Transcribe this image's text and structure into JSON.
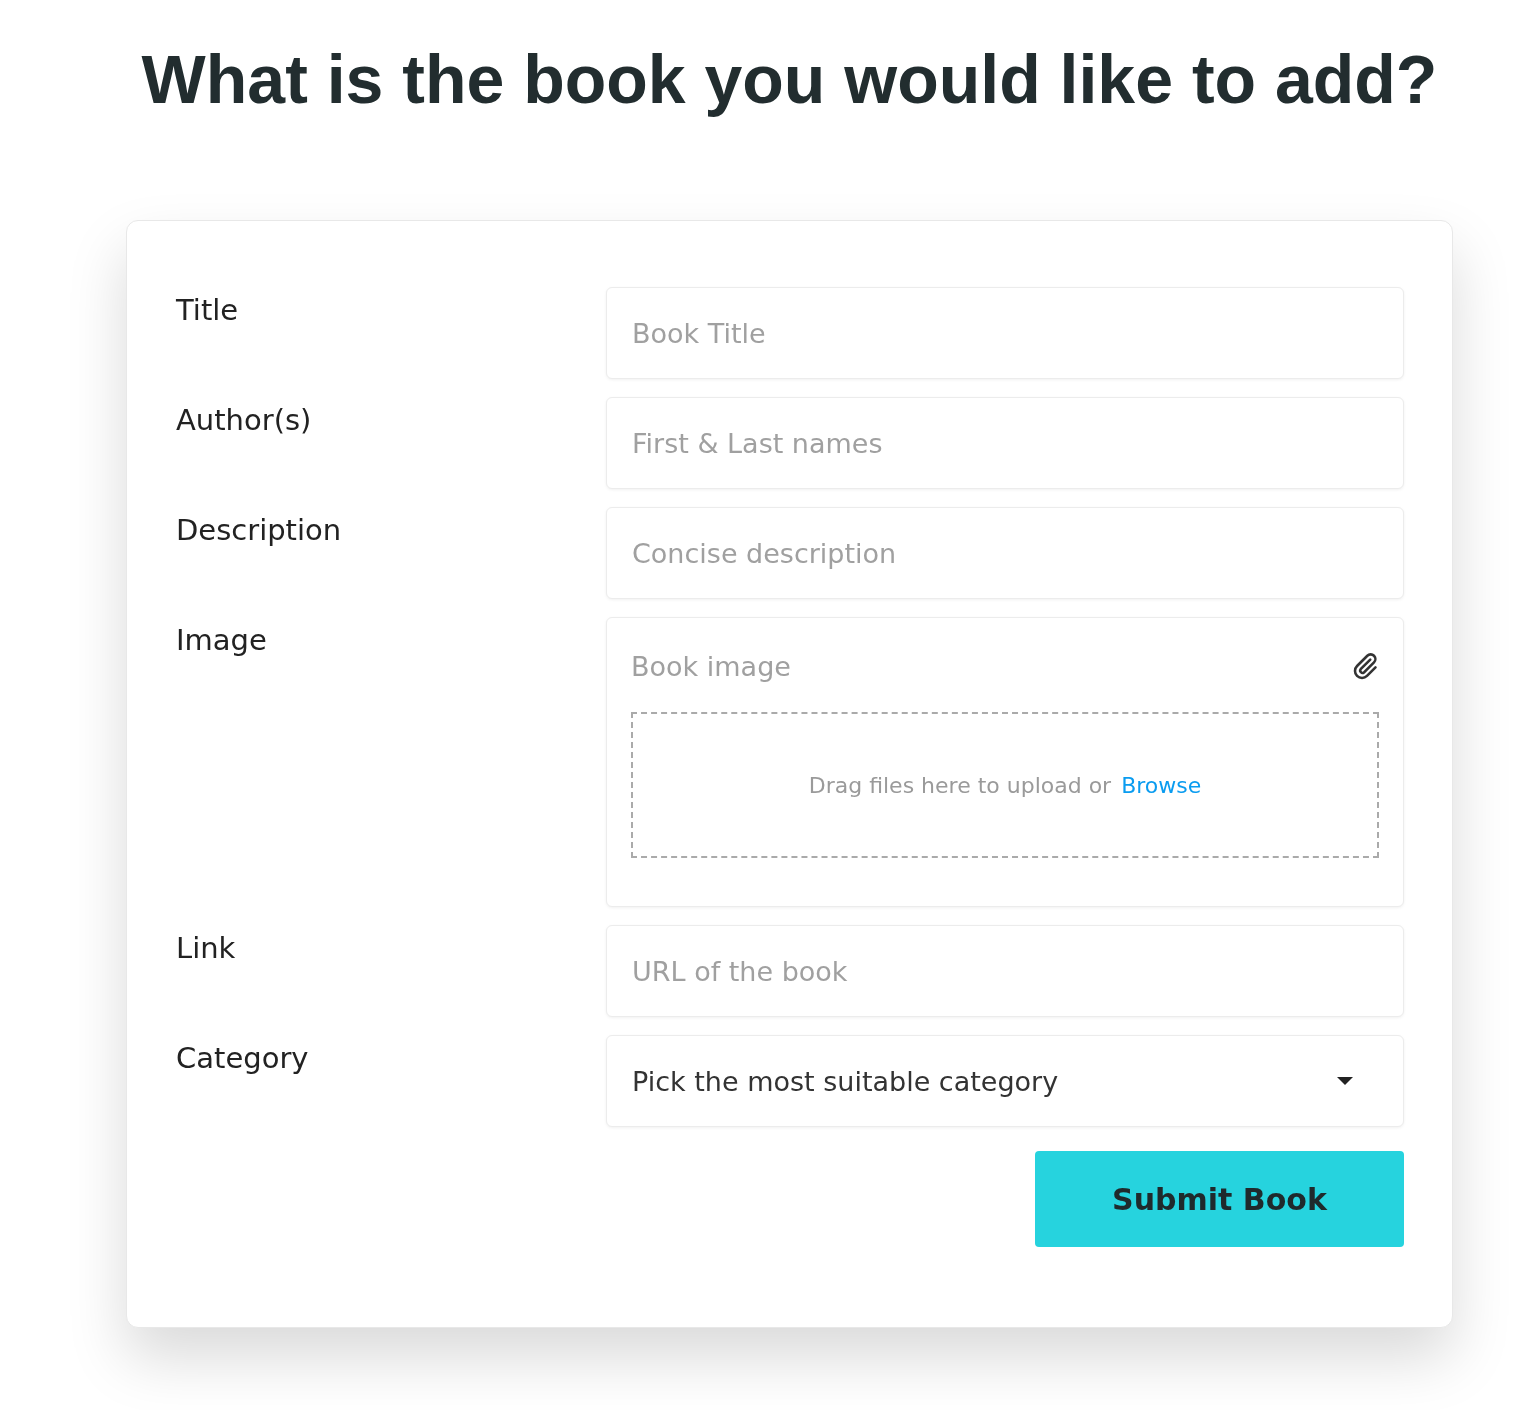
{
  "heading": "What is the book you would like to add?",
  "fields": [
    {
      "label": "Title",
      "kind": "text",
      "placeholder": "Book Title"
    },
    {
      "label": "Author(s)",
      "kind": "text",
      "placeholder": "First & Last names"
    },
    {
      "label": "Description",
      "kind": "text",
      "placeholder": "Concise description"
    },
    {
      "label": "Image",
      "kind": "file",
      "placeholder": "Book image",
      "drop_text": "Drag files here to upload or",
      "browse": "Browse"
    },
    {
      "label": "Link",
      "kind": "text",
      "placeholder": "URL of the book"
    },
    {
      "label": "Category",
      "kind": "select",
      "value": "Pick the most suitable category"
    }
  ],
  "submit": "Submit Book"
}
